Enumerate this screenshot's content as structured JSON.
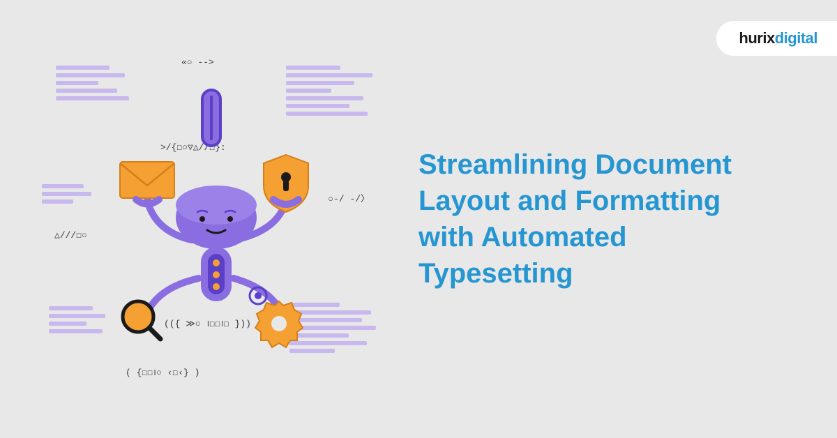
{
  "logo": {
    "part1": "hurix",
    "part2": "digital"
  },
  "headline": "Streamlining Document Layout and Formatting with Automated Typesetting",
  "illustration": {
    "code_snippets": [
      "«○ -->",
      ">/{☐○▽△//☐}:",
      "○-/ -/〉",
      "△///☐○",
      "(({ ≫○ ।☐☐।☐ }))",
      "( {☐☐।○ ‹☐‹} )"
    ],
    "colors": {
      "robot_body": "#8a6de0",
      "robot_dark": "#5a3fc7",
      "accent_orange": "#f5a033",
      "accent_dark": "#1a1a1a",
      "text_stripe": "#c9b8ed"
    }
  }
}
